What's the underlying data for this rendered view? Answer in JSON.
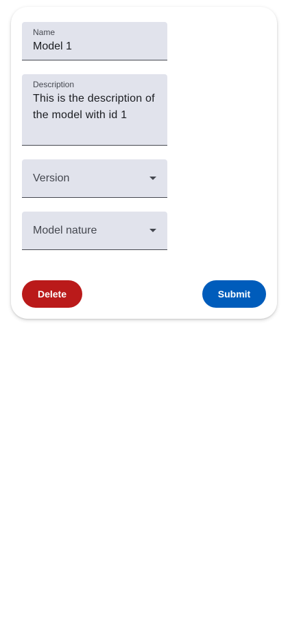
{
  "form": {
    "name": {
      "label": "Name",
      "value": "Model 1"
    },
    "description": {
      "label": "Description",
      "value": "This is the description of the model with id 1"
    },
    "version": {
      "label": "Version",
      "icon": "dropdown-arrow-icon"
    },
    "model_nature": {
      "label": "Model nature",
      "icon": "dropdown-arrow-icon"
    },
    "actions": {
      "delete_label": "Delete",
      "submit_label": "Submit"
    }
  },
  "colors": {
    "field_background": "#e1e3ec",
    "delete_button": "#ba1a1a",
    "submit_button": "#005cbb",
    "text_primary": "#1a1c20",
    "text_secondary": "#44474f"
  }
}
